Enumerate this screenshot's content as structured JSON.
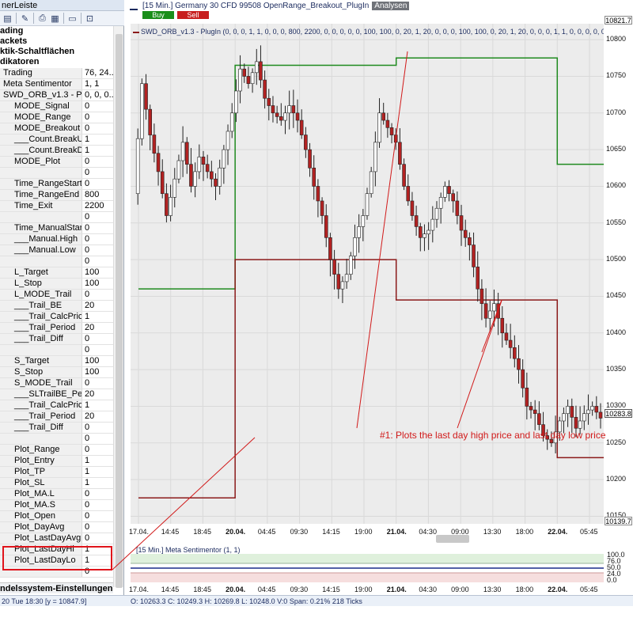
{
  "left_panel": {
    "title": "nerLeiste",
    "sections": [
      "ading",
      "ackets",
      "ktik-Schaltflächen",
      "dikatoren"
    ],
    "properties": [
      {
        "name": "Trading",
        "value": "76, 24...",
        "indent": 0
      },
      {
        "name": "Meta Sentimentor",
        "value": "1, 1",
        "indent": 0
      },
      {
        "name": "SWD_ORB_v1.3 - Plu...",
        "value": "0, 0, 0...",
        "indent": 0
      },
      {
        "name": "MODE_Signal",
        "value": "0",
        "indent": 1
      },
      {
        "name": "MODE_Range",
        "value": "0",
        "indent": 1
      },
      {
        "name": "MODE_Breakout",
        "value": "0",
        "indent": 1
      },
      {
        "name": "___Count.BreakUp",
        "value": "1",
        "indent": 1
      },
      {
        "name": "___Count.BreakDn",
        "value": "1",
        "indent": 1
      },
      {
        "name": "MODE_Plot",
        "value": "0",
        "indent": 1
      },
      {
        "name": "",
        "value": "0",
        "indent": 1
      },
      {
        "name": "Time_RangeStart",
        "value": "0",
        "indent": 1
      },
      {
        "name": "Time_RangeEnd",
        "value": "800",
        "indent": 1
      },
      {
        "name": "Time_Exit",
        "value": "2200",
        "indent": 1
      },
      {
        "name": "",
        "value": "0",
        "indent": 1
      },
      {
        "name": "Time_ManualStart",
        "value": "0",
        "indent": 1
      },
      {
        "name": "___Manual.High",
        "value": "0",
        "indent": 1
      },
      {
        "name": "___Manual.Low",
        "value": "0",
        "indent": 1
      },
      {
        "name": "",
        "value": "0",
        "indent": 1
      },
      {
        "name": "L_Target",
        "value": "100",
        "indent": 1
      },
      {
        "name": "L_Stop",
        "value": "100",
        "indent": 1
      },
      {
        "name": "L_MODE_Trail",
        "value": "0",
        "indent": 1
      },
      {
        "name": "___Trail_BE",
        "value": "20",
        "indent": 1
      },
      {
        "name": "___Trail_CalcPrice",
        "value": "1",
        "indent": 1
      },
      {
        "name": "___Trail_Period",
        "value": "20",
        "indent": 1
      },
      {
        "name": "___Trail_Diff",
        "value": "0",
        "indent": 1
      },
      {
        "name": "",
        "value": "0",
        "indent": 1
      },
      {
        "name": "S_Target",
        "value": "100",
        "indent": 1
      },
      {
        "name": "S_Stop",
        "value": "100",
        "indent": 1
      },
      {
        "name": "S_MODE_Trail",
        "value": "0",
        "indent": 1
      },
      {
        "name": "___SLTrailBE_Perc",
        "value": "20",
        "indent": 1
      },
      {
        "name": "___Trail_CalcPrice",
        "value": "1",
        "indent": 1
      },
      {
        "name": "___Trail_Period",
        "value": "20",
        "indent": 1
      },
      {
        "name": "___Trail_Diff",
        "value": "0",
        "indent": 1
      },
      {
        "name": "",
        "value": "0",
        "indent": 1
      },
      {
        "name": "Plot_Range",
        "value": "0",
        "indent": 1
      },
      {
        "name": "Plot_Entry",
        "value": "1",
        "indent": 1
      },
      {
        "name": "Plot_TP",
        "value": "1",
        "indent": 1
      },
      {
        "name": "Plot_SL",
        "value": "1",
        "indent": 1
      },
      {
        "name": "Plot_MA.L",
        "value": "0",
        "indent": 1
      },
      {
        "name": "Plot_MA.S",
        "value": "0",
        "indent": 1
      },
      {
        "name": "Plot_Open",
        "value": "0",
        "indent": 1
      },
      {
        "name": "Plot_DayAvg",
        "value": "0",
        "indent": 1
      },
      {
        "name": "Plot_LastDayAvg",
        "value": "0",
        "indent": 1
      },
      {
        "name": "Plot_LastDayHi",
        "value": "1",
        "indent": 1
      },
      {
        "name": "Plot_LastDayLo",
        "value": "1",
        "indent": 1
      },
      {
        "name": "",
        "value": "0",
        "indent": 1
      }
    ],
    "footer": "ndelssystem-Einstellungen"
  },
  "chart_header": {
    "title": "[15 Min.] Germany 30 CFD   99508 OpenRange_Breakout_PlugIn",
    "analysen": "Analysen",
    "buy": "Buy",
    "sell": "Sell",
    "indicator": "SWD_ORB_v1.3 - PlugIn   (0, 0, 0, 1, 1, 0, 0, 0, 800, 2200, 0, 0, 0, 0, 0, 100, 100, 0, 20, 1, 20, 0, 0, 0, 100, 100, 0, 20, 1, 20, 0, 0, 0, 1, 1, 0, 0, 0, 0, 0,"
  },
  "annotation": "#1: Plots the last day high price and last day low price",
  "price_boxes": {
    "top": "10821.7",
    "last": "10283.8",
    "bottom": "10139.7"
  },
  "sub_panel": {
    "title": "[15 Min.] Meta Sentimentor  (1, 1)",
    "ticks": [
      "100.0",
      "76.0",
      "50.0",
      "24.0",
      "0.0"
    ]
  },
  "status": {
    "left": "20 Tue  18:30 [y = 10847.9]",
    "right": "O: 10263.3 C: 10249.3 H: 10269.8 L: 10248.0 V:0 Span: 0.21% 218 Ticks"
  },
  "colors": {
    "range_high": "#1f8a1f",
    "range_low": "#8b1a1a",
    "annotation": "#d11a1a"
  },
  "icons": [
    "trading-icon",
    "chart-icon",
    "print-icon",
    "config-icon",
    "window-icon",
    "pin-icon"
  ],
  "chart_data": {
    "type": "candlestick",
    "y_ticks": [
      10800,
      10750,
      10700,
      10650,
      10600,
      10550,
      10500,
      10450,
      10400,
      10350,
      10300,
      10250,
      10200,
      10150
    ],
    "ylim": [
      10139.7,
      10821.7
    ],
    "x_ticks": [
      "17.04.",
      "14:45",
      "18:45",
      "20.04.",
      "04:45",
      "09:30",
      "14:15",
      "19:00",
      "21.04.",
      "04:30",
      "09:00",
      "13:30",
      "18:00",
      "22.04.",
      "05:45"
    ],
    "x_bold": [
      "20.04.",
      "21.04.",
      "22.04."
    ],
    "last_day_high": [
      {
        "from": "17.04.",
        "to": "20.04.",
        "value": 10460
      },
      {
        "from": "20.04.",
        "to": "21.04.",
        "value": 10765
      },
      {
        "from": "21.04.",
        "to": "22.04.",
        "value": 10775
      },
      {
        "from": "22.04.",
        "to": "05:45",
        "value": 10630
      }
    ],
    "last_day_low": [
      {
        "from": "17.04.",
        "to": "20.04.",
        "value": 10175
      },
      {
        "from": "20.04.",
        "to": "21.04.",
        "value": 10500
      },
      {
        "from": "21.04.",
        "to": "22.04.",
        "value": 10445
      },
      {
        "from": "22.04.",
        "to": "05:45",
        "value": 10230
      }
    ],
    "price_path": [
      10590,
      10740,
      10670,
      10620,
      10560,
      10610,
      10660,
      10600,
      10640,
      10620,
      10600,
      10650,
      10700,
      10760,
      10740,
      10770,
      10720,
      10700,
      10690,
      10710,
      10690,
      10650,
      10600,
      10560,
      10500,
      10460,
      10480,
      10530,
      10560,
      10620,
      10700,
      10680,
      10660,
      10600,
      10560,
      10530,
      10540,
      10570,
      10600,
      10580,
      10540,
      10520,
      10460,
      10420,
      10440,
      10400,
      10380,
      10350,
      10300,
      10290,
      10260,
      10250,
      10280,
      10300,
      10270,
      10290,
      10300,
      10283.8
    ],
    "sentiment": {
      "value": 50.0
    }
  }
}
